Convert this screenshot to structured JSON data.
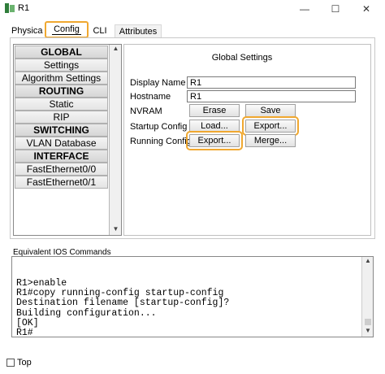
{
  "window": {
    "title": "R1",
    "minimize_glyph": "—",
    "maximize_glyph": "☐",
    "close_glyph": "✕"
  },
  "tabs": [
    {
      "label": "Physica"
    },
    {
      "label": "Config"
    },
    {
      "label": "CLI"
    },
    {
      "label": "Attributes"
    }
  ],
  "sidebar": {
    "items": [
      {
        "label": "GLOBAL",
        "header": true
      },
      {
        "label": "Settings"
      },
      {
        "label": "Algorithm Settings"
      },
      {
        "label": "ROUTING",
        "header": true
      },
      {
        "label": "Static"
      },
      {
        "label": "RIP"
      },
      {
        "label": "SWITCHING",
        "header": true
      },
      {
        "label": "VLAN Database"
      },
      {
        "label": "INTERFACE",
        "header": true
      },
      {
        "label": "FastEthernet0/0"
      },
      {
        "label": "FastEthernet0/1"
      }
    ]
  },
  "global_settings": {
    "title": "Global Settings",
    "display_name_label": "Display Name",
    "display_name_value": "R1",
    "hostname_label": "Hostname",
    "hostname_value": "R1",
    "nvram_label": "NVRAM",
    "erase_label": "Erase",
    "save_label": "Save",
    "startup_label": "Startup Config",
    "load_label": "Load...",
    "startup_export_label": "Export...",
    "running_label": "Running Config",
    "running_export_label": "Export...",
    "merge_label": "Merge..."
  },
  "ios": {
    "label": "Equivalent IOS Commands",
    "console_text": "R1>enable\nR1#copy running-config startup-config\nDestination filename [startup-config]?\nBuilding configuration...\n[OK]\nR1#"
  },
  "footer": {
    "top_label": "Top"
  },
  "colors": {
    "highlight": "#f0a830"
  }
}
